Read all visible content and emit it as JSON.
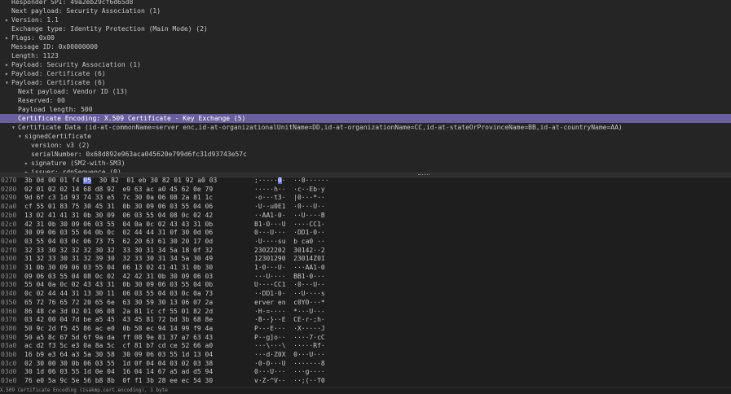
{
  "tree": {
    "rows": [
      {
        "indent": 3,
        "arrow": "",
        "text": "Responder SPI: 49a2eb29cf6d65d8",
        "selected": false
      },
      {
        "indent": 3,
        "arrow": "",
        "text": "Next payload: Security Association (1)",
        "selected": false
      },
      {
        "indent": 1,
        "arrow": "▸",
        "text": "Version: 1.1",
        "selected": false
      },
      {
        "indent": 3,
        "arrow": "",
        "text": "Exchange type: Identity Protection (Main Mode) (2)",
        "selected": false
      },
      {
        "indent": 1,
        "arrow": "▸",
        "text": "Flags: 0x00",
        "selected": false
      },
      {
        "indent": 3,
        "arrow": "",
        "text": "Message ID: 0x00000000",
        "selected": false
      },
      {
        "indent": 3,
        "arrow": "",
        "text": "Length: 1123",
        "selected": false
      },
      {
        "indent": 1,
        "arrow": "▸",
        "text": "Payload: Security Association (1)",
        "selected": false
      },
      {
        "indent": 1,
        "arrow": "▸",
        "text": "Payload: Certificate (6)",
        "selected": false
      },
      {
        "indent": 1,
        "arrow": "▾",
        "text": "Payload: Certificate (6)",
        "selected": false
      },
      {
        "indent": 5,
        "arrow": "",
        "text": "Next payload: Vendor ID (13)",
        "selected": false
      },
      {
        "indent": 5,
        "arrow": "",
        "text": "Reserved: 00",
        "selected": false
      },
      {
        "indent": 5,
        "arrow": "",
        "text": "Payload length: 500",
        "selected": false
      },
      {
        "indent": 5,
        "arrow": "",
        "text": "Certificate Encoding: X.509 Certificate - Key Exchange (5)",
        "selected": true
      },
      {
        "indent": 3,
        "arrow": "▾",
        "text": "Certificate Data (id-at-commonName=server enc,id-at-organizationalUnitName=DD,id-at-organizationName=CC,id-at-stateOrProvinceName=BB,id-at-countryName=AA)",
        "selected": false
      },
      {
        "indent": 5,
        "arrow": "▾",
        "text": "signedCertificate",
        "selected": false
      },
      {
        "indent": 9,
        "arrow": "",
        "text": "version: v3 (2)",
        "selected": false
      },
      {
        "indent": 9,
        "arrow": "",
        "text": "serialNumber: 0x68d892e963aca045620e799d6fc31d93743e57c",
        "selected": false
      },
      {
        "indent": 7,
        "arrow": "▸",
        "text": "signature (SM2-with-SM3)",
        "selected": false
      },
      {
        "indent": 7,
        "arrow": "▸",
        "text": "issuer: rdnSequence (0)",
        "selected": false
      }
    ]
  },
  "hex": {
    "highlight": {
      "row": 0,
      "byte": 5,
      "ascii_index": 6
    },
    "rows": [
      {
        "offset": "0270",
        "bytes": "3b 0d 00 01 f4 05  30 82  01 eb 30 82 01 92 a0 03",
        "ascii": ";·····0·  ··0······"
      },
      {
        "offset": "0280",
        "bytes": "02 01 02 02 14 68 d8 92  e9 63 ac a0 45 62 0e 79",
        "ascii": "·····h··  ·c··Eb·y"
      },
      {
        "offset": "0290",
        "bytes": "9d 6f c3 1d 93 74 33 e5  7c 30 0a 06 08 2a 81 1c",
        "ascii": "·o···t3·  |0···*··"
      },
      {
        "offset": "02a0",
        "bytes": "cf 55 01 83 75 30 45 31  0b 30 09 06 03 55 04 06",
        "ascii": "·U··u0E1  ·0···U··"
      },
      {
        "offset": "02b0",
        "bytes": "13 02 41 41 31 0b 30 09  06 03 55 04 08 0c 02 42",
        "ascii": "··AA1·0·  ··U····B"
      },
      {
        "offset": "02c0",
        "bytes": "42 31 0b 30 09 06 03 55  04 0a 0c 02 43 43 31 0b",
        "ascii": "B1·0···U  ····CC1·"
      },
      {
        "offset": "02d0",
        "bytes": "30 09 06 03 55 04 0b 0c  02 44 44 31 0f 30 0d 06",
        "ascii": "0···U···  ·DD1·0··"
      },
      {
        "offset": "02e0",
        "bytes": "03 55 04 03 0c 06 73 75  62 20 63 61 30 20 17 0d",
        "ascii": "·U····su  b ca0 ··"
      },
      {
        "offset": "02f0",
        "bytes": "32 33 30 32 32 32 30 32  33 30 31 34 5a 18 0f 32",
        "ascii": "23022202  30142··2"
      },
      {
        "offset": "0300",
        "bytes": "31 32 33 30 31 32 39 30  32 33 30 31 34 5a 30 49",
        "ascii": "12301290  23014Z0I"
      },
      {
        "offset": "0310",
        "bytes": "31 0b 30 09 06 03 55 04  06 13 02 41 41 31 0b 30",
        "ascii": "1·0···U·  ···AA1·0"
      },
      {
        "offset": "0320",
        "bytes": "09 06 03 55 04 08 0c 02  42 42 31 0b 30 09 06 03",
        "ascii": "···U····  BB1·0···"
      },
      {
        "offset": "0330",
        "bytes": "55 04 0a 0c 02 43 43 31  0b 30 09 06 03 55 04 0b",
        "ascii": "U····CC1  ·0···U··"
      },
      {
        "offset": "0340",
        "bytes": "0c 02 44 44 31 13 30 11  06 03 55 04 03 0c 0a 73",
        "ascii": "··DD1·0·  ··U····s"
      },
      {
        "offset": "0350",
        "bytes": "65 72 76 65 72 20 65 6e  63 30 59 30 13 06 07 2a",
        "ascii": "erver en  c0Y0···*"
      },
      {
        "offset": "0360",
        "bytes": "86 48 ce 3d 02 01 06 08  2a 81 1c cf 55 01 82 2d",
        "ascii": "·H·=····  *···U··-"
      },
      {
        "offset": "0370",
        "bytes": "03 42 00 04 7d be a5 45  43 45 81 72 bd 3b 68 8e",
        "ascii": "·B··}··E  CE·r·;h·"
      },
      {
        "offset": "0380",
        "bytes": "50 9c 2d f5 45 86 ac e0  0b 58 ec 94 14 99 f9 4a",
        "ascii": "P·-·E···  ·X·····J"
      },
      {
        "offset": "0390",
        "bytes": "50 a5 8c 67 5d 6f 9a da  ff 08 9e 81 37 a7 63 43",
        "ascii": "P··g]o··  ····7·cC"
      },
      {
        "offset": "03a0",
        "bytes": "ac d2 f3 5c e3 0a 8a 5c  cf 81 b7 cd ce 52 66 a0",
        "ascii": "···\\···\\  ·····Rf·"
      },
      {
        "offset": "03b0",
        "bytes": "16 b9 e3 64 a3 5a 30 58  30 09 06 03 55 1d 13 04",
        "ascii": "···d·Z0X  0···U···"
      },
      {
        "offset": "03c0",
        "bytes": "02 30 00 30 0b 06 03 55  1d 0f 04 04 03 02 03 38",
        "ascii": "·0·0···U  ·······8"
      },
      {
        "offset": "03d0",
        "bytes": "30 1d 06 03 55 1d 0e 04  16 04 14 67 a5 ad d5 94",
        "ascii": "0···U···  ···g····"
      },
      {
        "offset": "03e0",
        "bytes": "76 e0 5a 9c 5e 56 b8 8b  0f f1 3b 28 ee ec 54 30",
        "ascii": "v·Z·^V··  ··;(··T0"
      }
    ]
  },
  "status": {
    "text": "X.509 Certificate Encoding (isakmp.cert.encoding), 1 byte"
  }
}
